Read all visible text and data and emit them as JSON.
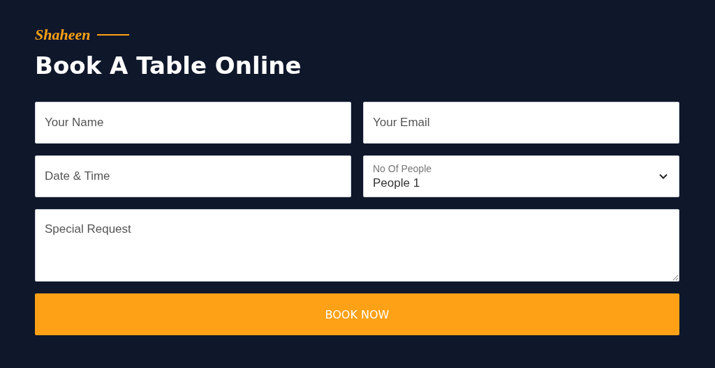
{
  "subtitle": "Shaheen",
  "title": "Book A Table Online",
  "rows": [
    [
      {
        "kind": "input",
        "placeholder": "Your Name"
      },
      {
        "kind": "input",
        "placeholder": "Your Email"
      }
    ],
    [
      {
        "kind": "input",
        "placeholder": "Date & Time"
      },
      {
        "kind": "select",
        "label": "No Of People",
        "value": "People 1"
      }
    ],
    [
      {
        "kind": "textarea",
        "placeholder": "Special Request"
      }
    ]
  ],
  "button": "BOOK NOW"
}
